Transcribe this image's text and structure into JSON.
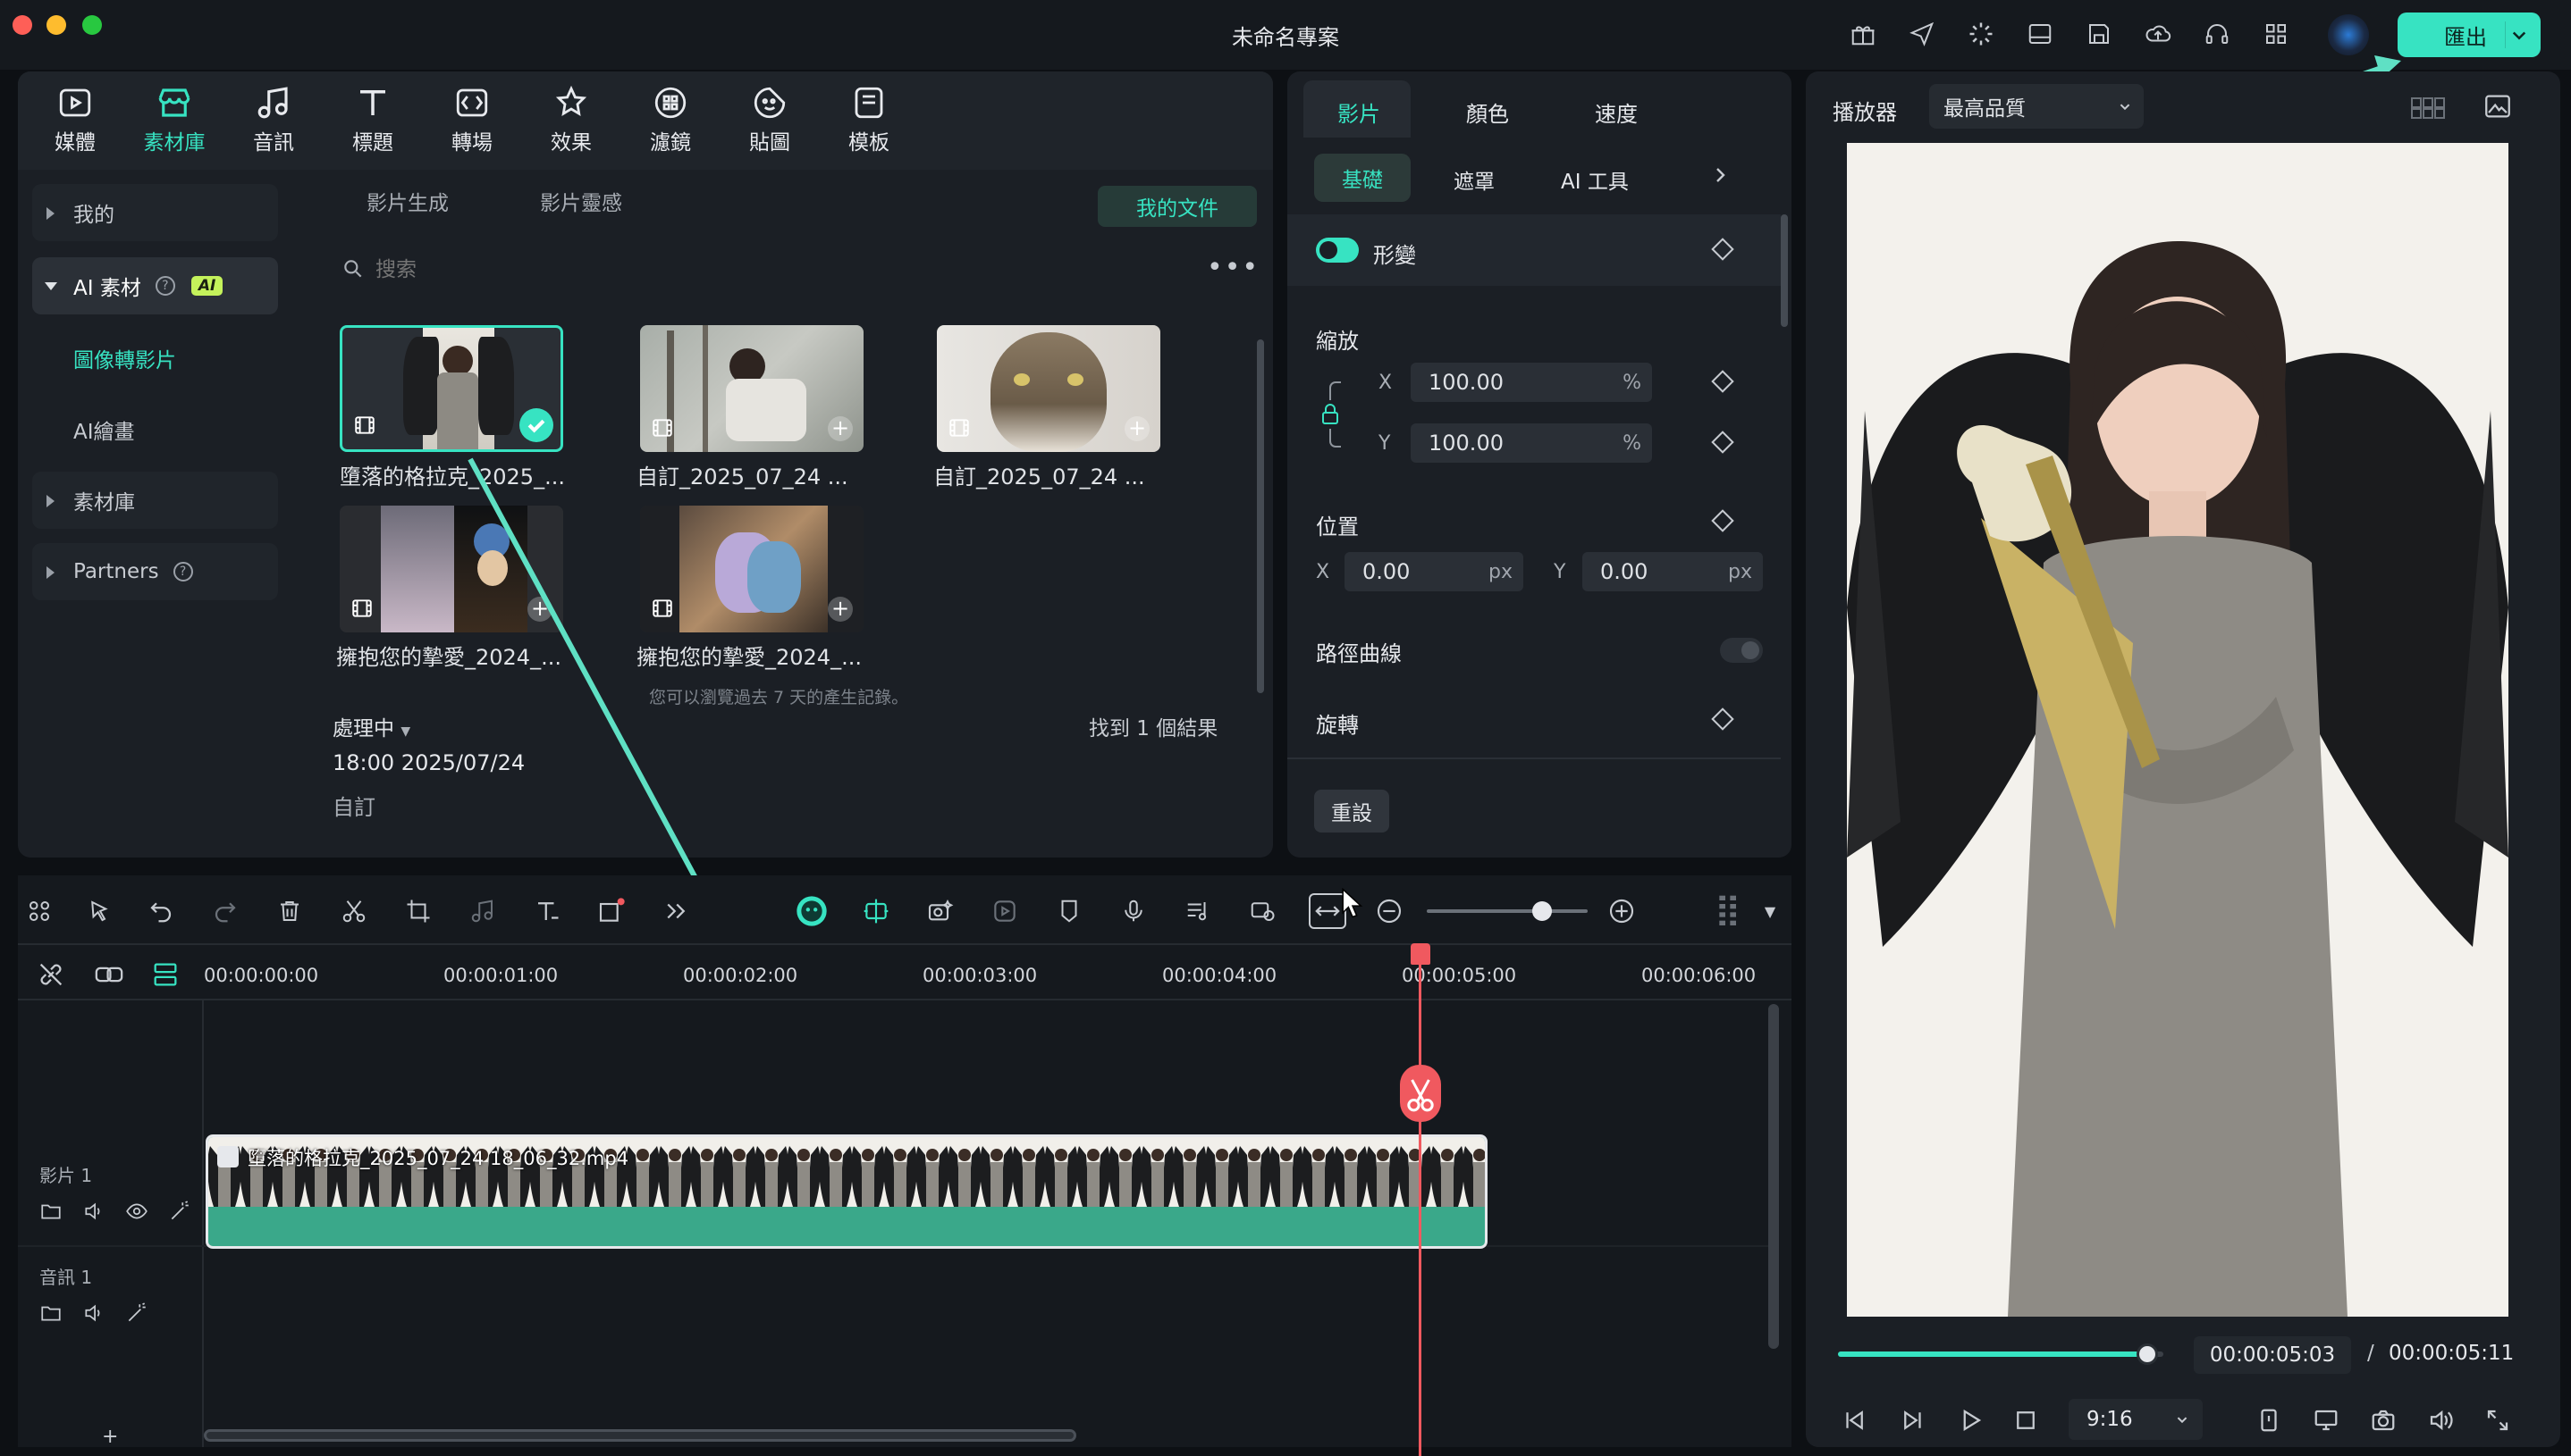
{
  "window": {
    "title": "未命名專案",
    "export_label": "匯出"
  },
  "toolbar_icons": [
    "gift-icon",
    "send-icon",
    "loading-icon",
    "layout-icon",
    "save-icon",
    "cloud-upload-icon",
    "headset-icon",
    "grid-apps-icon"
  ],
  "media_tabs": [
    {
      "label": "媒體",
      "icon": "media-icon"
    },
    {
      "label": "素材庫",
      "icon": "store-icon",
      "active": true
    },
    {
      "label": "音訊",
      "icon": "music-icon"
    },
    {
      "label": "標題",
      "icon": "title-icon"
    },
    {
      "label": "轉場",
      "icon": "transition-icon"
    },
    {
      "label": "效果",
      "icon": "effects-icon"
    },
    {
      "label": "濾鏡",
      "icon": "filter-icon"
    },
    {
      "label": "貼圖",
      "icon": "sticker-icon"
    },
    {
      "label": "模板",
      "icon": "template-icon"
    }
  ],
  "sidebar": {
    "mine": "我的",
    "ai_assets": "AI 素材",
    "ai_badge": "AI",
    "image_to_video": "圖像轉影片",
    "ai_drawing": "AI繪畫",
    "library": "素材庫",
    "partners": "Partners"
  },
  "library": {
    "subtabs": [
      "影片生成",
      "影片靈感"
    ],
    "my_files": "我的文件",
    "search_placeholder": "搜索",
    "items": [
      {
        "caption": "墮落的格拉克_2025_..."
      },
      {
        "caption": "自訂_2025_07_24 ..."
      },
      {
        "caption": "自訂_2025_07_24 ..."
      },
      {
        "caption": "擁抱您的摯愛_2024_..."
      },
      {
        "caption": "擁抱您的摯愛_2024_..."
      }
    ],
    "history_note": "您可以瀏覽過去 7 天的產生記錄。",
    "processing": "處理中",
    "results": "找到 1 個結果",
    "processing_time": "18:00 2025/07/24",
    "processing_type": "自訂"
  },
  "properties": {
    "tabs": [
      "影片",
      "顏色",
      "速度"
    ],
    "subtabs": [
      "基礎",
      "遮罩",
      "AI 工具"
    ],
    "transform": "形變",
    "scale": "縮放",
    "scale_x": "100.00",
    "scale_y": "100.00",
    "percent": "%",
    "position": "位置",
    "pos_x": "0.00",
    "pos_y": "0.00",
    "px": "px",
    "x": "X",
    "y": "Y",
    "path_curve": "路徑曲線",
    "rotate": "旋轉",
    "reset": "重設"
  },
  "player": {
    "label": "播放器",
    "quality": "最高品質",
    "current_time": "00:00:05:03",
    "separator": "/",
    "total_time": "00:00:05:11",
    "aspect": "9:16",
    "progress": 0.95
  },
  "timeline": {
    "ticks": [
      "00:00:00:00",
      "00:00:01:00",
      "00:00:02:00",
      "00:00:03:00",
      "00:00:04:00",
      "00:00:05:00",
      "00:00:06:00"
    ],
    "clip_name": "墮落的格拉克_2025_07_24 18_06_32.mp4",
    "video_track": "影片 1",
    "audio_track": "音訊 1",
    "add": "+"
  },
  "colors": {
    "accent": "#37e3c2",
    "playhead": "#f0595f",
    "clip": "#3aa88a"
  }
}
